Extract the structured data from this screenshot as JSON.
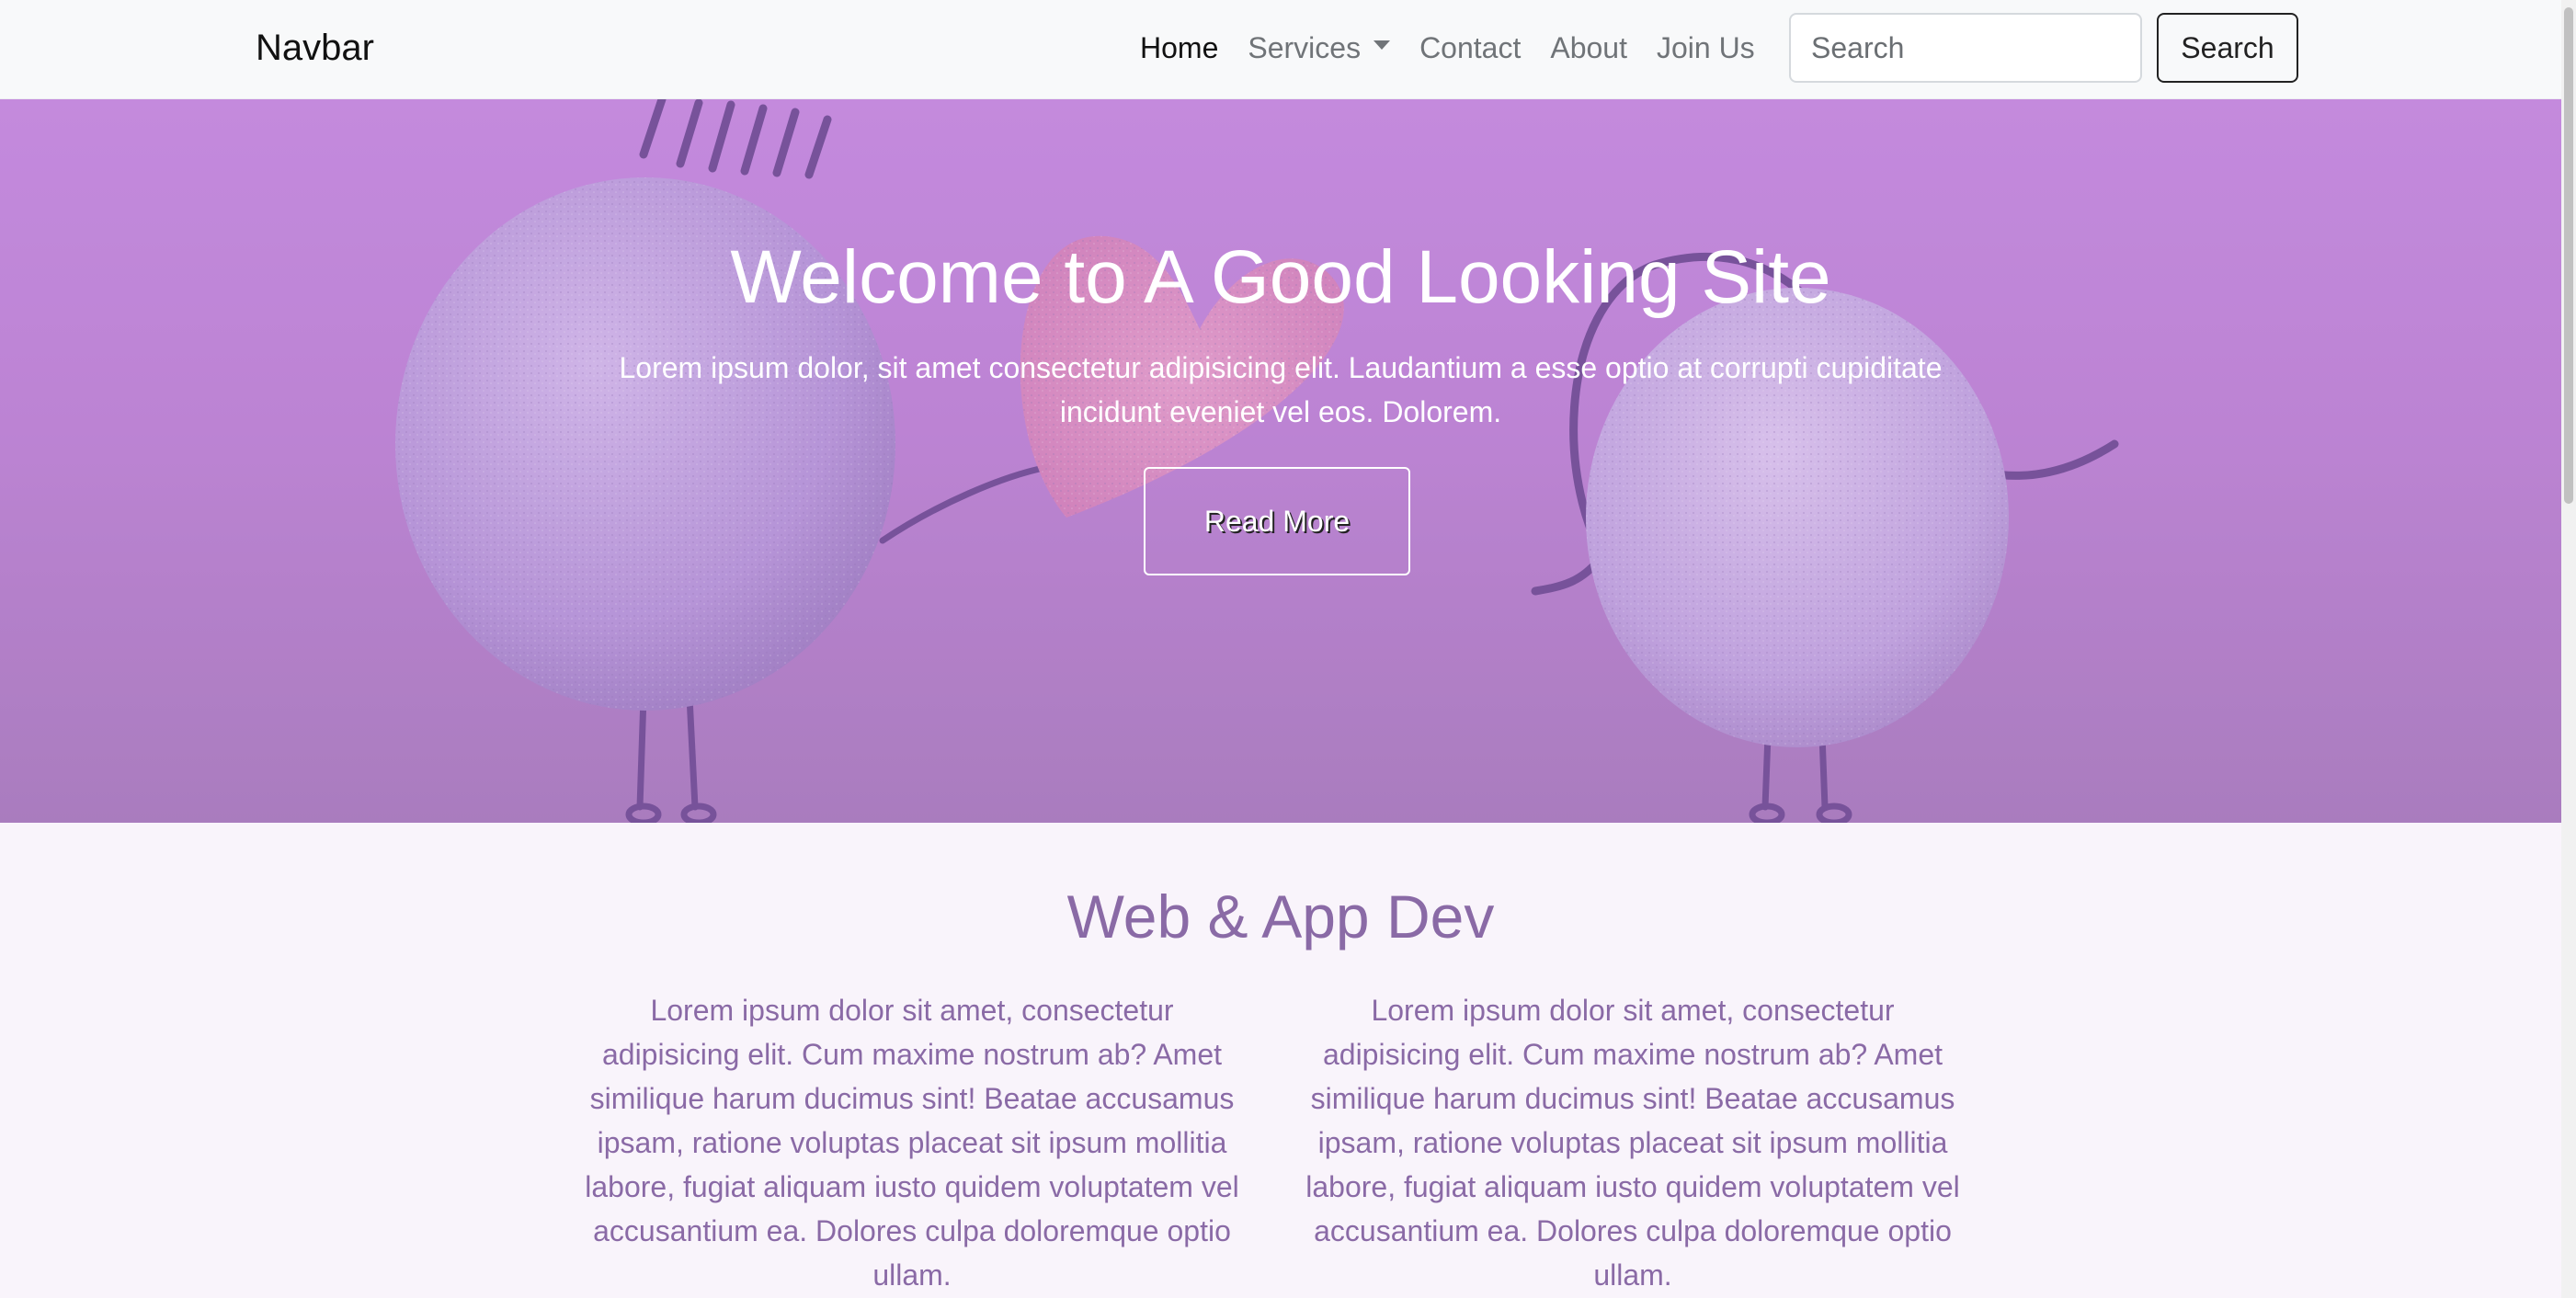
{
  "navbar": {
    "brand": "Navbar",
    "links": [
      {
        "label": "Home",
        "active": true
      },
      {
        "label": "Services",
        "dropdown": true
      },
      {
        "label": "Contact"
      },
      {
        "label": "About"
      },
      {
        "label": "Join Us"
      }
    ],
    "search_placeholder": "Search",
    "search_button": "Search"
  },
  "hero": {
    "title": "Welcome to A Good Looking Site",
    "text": "Lorem ipsum dolor, sit amet consectetur adipisicing elit. Laudantium a esse optio at corrupti cupiditate incidunt eveniet vel eos. Dolorem.",
    "button": "Read More"
  },
  "section": {
    "title": "Web & App Dev",
    "columns": [
      "Lorem ipsum dolor sit amet, consectetur adipisicing elit. Cum maxime nostrum ab? Amet similique harum ducimus sint! Beatae accusamus ipsam, ratione voluptas placeat sit ipsum mollitia labore, fugiat aliquam iusto quidem voluptatem vel accusantium ea. Dolores culpa doloremque optio ullam.",
      "Lorem ipsum dolor sit amet, consectetur adipisicing elit. Cum maxime nostrum ab? Amet similique harum ducimus sint! Beatae accusamus ipsam, ratione voluptas placeat sit ipsum mollitia labore, fugiat aliquam iusto quidem voluptatem vel accusantium ea. Dolores culpa doloremque optio ullam."
    ]
  },
  "colors": {
    "navbar_bg": "#f8f9fa",
    "hero_bg": "#c88ee0",
    "accent_text": "#8a6aa6",
    "page_bg": "#f9f4fb"
  }
}
